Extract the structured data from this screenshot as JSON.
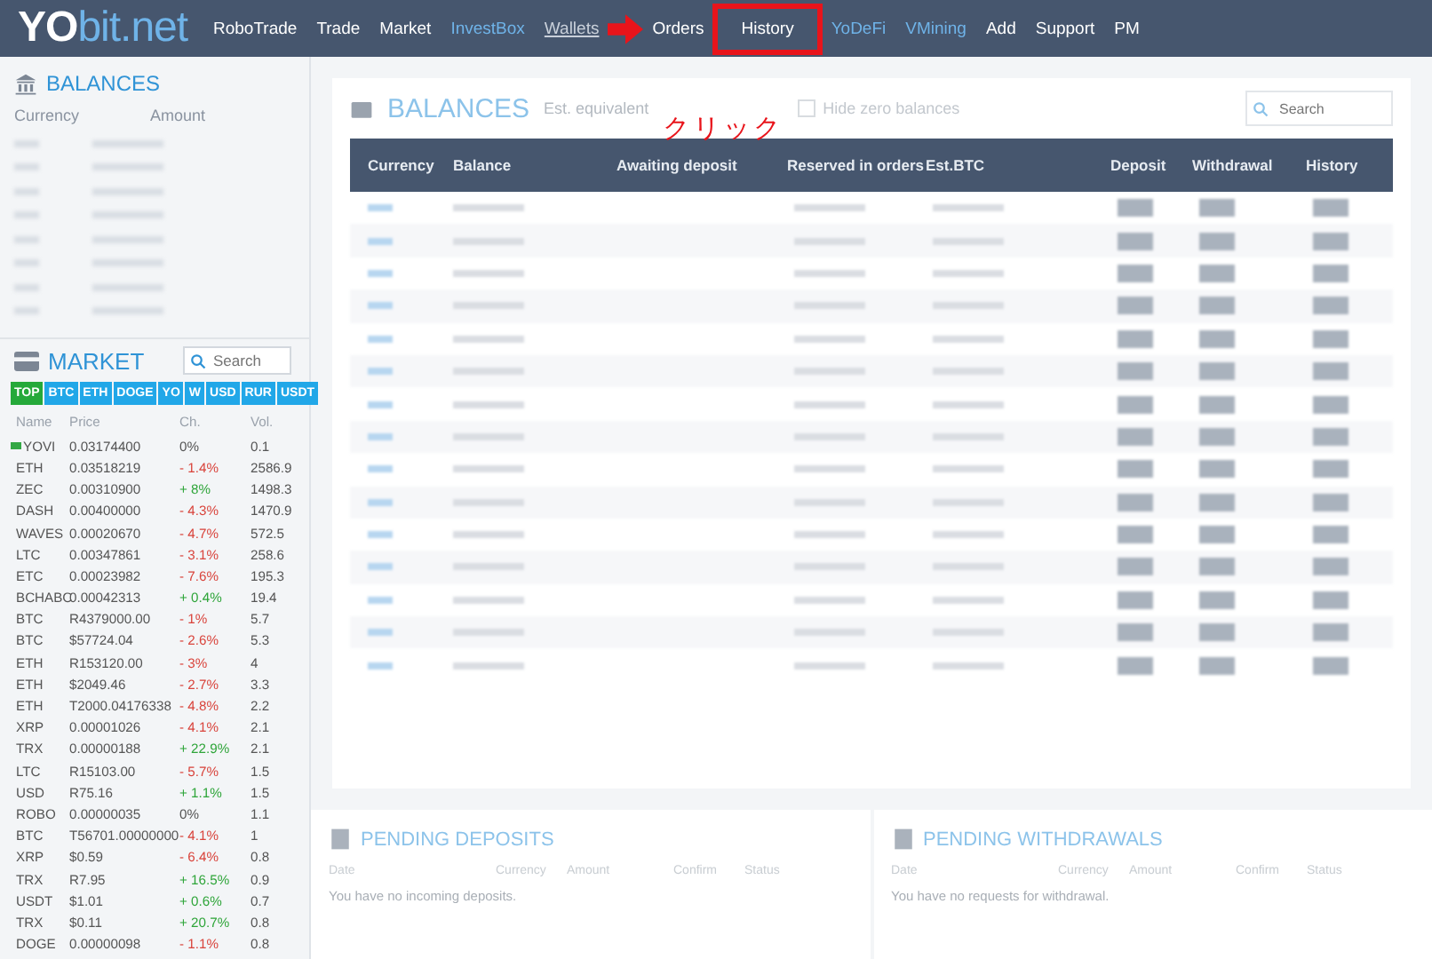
{
  "logo": {
    "part_1": "YO",
    "part_2": "bit.net"
  },
  "nav": [
    {
      "label": "RoboTrade",
      "kind": "plain"
    },
    {
      "label": "Trade",
      "kind": "plain"
    },
    {
      "label": "Market",
      "kind": "plain"
    },
    {
      "label": "InvestBox",
      "kind": "accent"
    },
    {
      "label": "Wallets",
      "kind": "current"
    },
    {
      "label": "Orders",
      "kind": "plain"
    },
    {
      "label": "History",
      "kind": "framed"
    },
    {
      "label": "YoDeFi",
      "kind": "accent"
    },
    {
      "label": "VMining",
      "kind": "accent"
    },
    {
      "label": "Add",
      "kind": "plain"
    },
    {
      "label": "Support",
      "kind": "plain"
    },
    {
      "label": "PM",
      "kind": "plain"
    }
  ],
  "annotation": {
    "text": "クリック"
  },
  "sidebar_balances": {
    "title": "BALANCES",
    "columns": [
      "Currency",
      "Amount"
    ]
  },
  "market": {
    "title": "MARKET",
    "search": {
      "placeholder": "Search"
    },
    "tabs": [
      {
        "label": "TOP",
        "selected": true
      },
      {
        "label": "BTC",
        "selected": false
      },
      {
        "label": "ETH",
        "selected": false
      },
      {
        "label": "DOGE",
        "selected": false
      },
      {
        "label": "YO",
        "selected": false
      },
      {
        "label": "W",
        "selected": false
      },
      {
        "label": "USD",
        "selected": false
      },
      {
        "label": "RUR",
        "selected": false
      },
      {
        "label": "USDT",
        "selected": false
      }
    ],
    "columns": [
      "Name",
      "Price",
      "Ch.",
      "Vol."
    ],
    "rows": [
      {
        "kind": "tagged",
        "name": "YOVI",
        "price": "0.03174400",
        "change": "0%",
        "color": "#555555",
        "volume": "0.1"
      },
      {
        "kind": "plain",
        "name": "ETH",
        "price": "0.03518219",
        "change": "- 1.4%",
        "color": "#d9443c",
        "volume": "2586.9"
      },
      {
        "kind": "plain",
        "name": "ZEC",
        "price": "0.00310900",
        "change": "+ 8%",
        "color": "#2fa53a",
        "volume": "1498.3"
      },
      {
        "kind": "plain",
        "name": "DASH",
        "price": "0.00400000",
        "change": "- 4.3%",
        "color": "#d9443c",
        "volume": "1470.9"
      },
      {
        "kind": "plain",
        "name": "WAVES",
        "price": "0.00020670",
        "change": "- 4.7%",
        "color": "#d9443c",
        "volume": "572.5"
      },
      {
        "kind": "plain",
        "name": "LTC",
        "price": "0.00347861",
        "change": "- 3.1%",
        "color": "#d9443c",
        "volume": "258.6"
      },
      {
        "kind": "plain",
        "name": "ETC",
        "price": "0.00023982",
        "change": "- 7.6%",
        "color": "#d9443c",
        "volume": "195.3"
      },
      {
        "kind": "plain",
        "name": "BCHABC",
        "price": "0.00042313",
        "change": "+ 0.4%",
        "color": "#2fa53a",
        "volume": "19.4"
      },
      {
        "kind": "plain",
        "name": "BTC",
        "price": "R4379000.00",
        "change": "- 1%",
        "color": "#d9443c",
        "volume": "5.7"
      },
      {
        "kind": "plain",
        "name": "BTC",
        "price": "$57724.04",
        "change": "- 2.6%",
        "color": "#d9443c",
        "volume": "5.3"
      },
      {
        "kind": "plain",
        "name": "ETH",
        "price": "R153120.00",
        "change": "- 3%",
        "color": "#d9443c",
        "volume": "4"
      },
      {
        "kind": "plain",
        "name": "ETH",
        "price": "$2049.46",
        "change": "- 2.7%",
        "color": "#d9443c",
        "volume": "3.3"
      },
      {
        "kind": "plain",
        "name": "ETH",
        "price": "T2000.04176338",
        "change": "- 4.8%",
        "color": "#d9443c",
        "volume": "2.2"
      },
      {
        "kind": "plain",
        "name": "XRP",
        "price": "0.00001026",
        "change": "- 4.1%",
        "color": "#d9443c",
        "volume": "2.1"
      },
      {
        "kind": "plain",
        "name": "TRX",
        "price": "0.00000188",
        "change": "+ 22.9%",
        "color": "#2fa53a",
        "volume": "2.1"
      },
      {
        "kind": "plain",
        "name": "LTC",
        "price": "R15103.00",
        "change": "- 5.7%",
        "color": "#d9443c",
        "volume": "1.5"
      },
      {
        "kind": "plain",
        "name": "USD",
        "price": "R75.16",
        "change": "+ 1.1%",
        "color": "#2fa53a",
        "volume": "1.5"
      },
      {
        "kind": "plain",
        "name": "ROBO",
        "price": "0.00000035",
        "change": "0%",
        "color": "#555555",
        "volume": "1.1"
      },
      {
        "kind": "plain",
        "name": "BTC",
        "price": "T56701.00000000",
        "change": "- 4.1%",
        "color": "#d9443c",
        "volume": "1"
      },
      {
        "kind": "plain",
        "name": "XRP",
        "price": "$0.59",
        "change": "- 6.4%",
        "color": "#d9443c",
        "volume": "0.8"
      },
      {
        "kind": "plain",
        "name": "TRX",
        "price": "R7.95",
        "change": "+ 16.5%",
        "color": "#2fa53a",
        "volume": "0.9"
      },
      {
        "kind": "plain",
        "name": "USDT",
        "price": "$1.01",
        "change": "+ 0.6%",
        "color": "#2fa53a",
        "volume": "0.7"
      },
      {
        "kind": "plain",
        "name": "TRX",
        "price": "$0.11",
        "change": "+ 20.7%",
        "color": "#2fa53a",
        "volume": "0.8"
      },
      {
        "kind": "plain",
        "name": "DOGE",
        "price": "0.00000098",
        "change": "- 1.1%",
        "color": "#d9443c",
        "volume": "0.8"
      }
    ]
  },
  "main": {
    "title": "BALANCES",
    "equivalent_label": "Est. equivalent",
    "hide_zero": {
      "label": "Hide zero balances",
      "checked": false
    },
    "search": {
      "placeholder": "Search"
    },
    "columns": [
      "Currency",
      "Balance",
      "Awaiting deposit",
      "Reserved in orders",
      "Est.BTC",
      "Deposit",
      "Withdrawal",
      "History"
    ]
  },
  "pending": [
    {
      "title": "PENDING DEPOSITS",
      "columns": [
        "Date",
        "Currency",
        "Amount",
        "Confirm",
        "Status"
      ],
      "message": "You have no incoming deposits."
    },
    {
      "title": "PENDING WITHDRAWALS",
      "columns": [
        "Date",
        "Currency",
        "Amount",
        "Confirm",
        "Status"
      ],
      "message": "You have no requests for withdrawal."
    }
  ]
}
